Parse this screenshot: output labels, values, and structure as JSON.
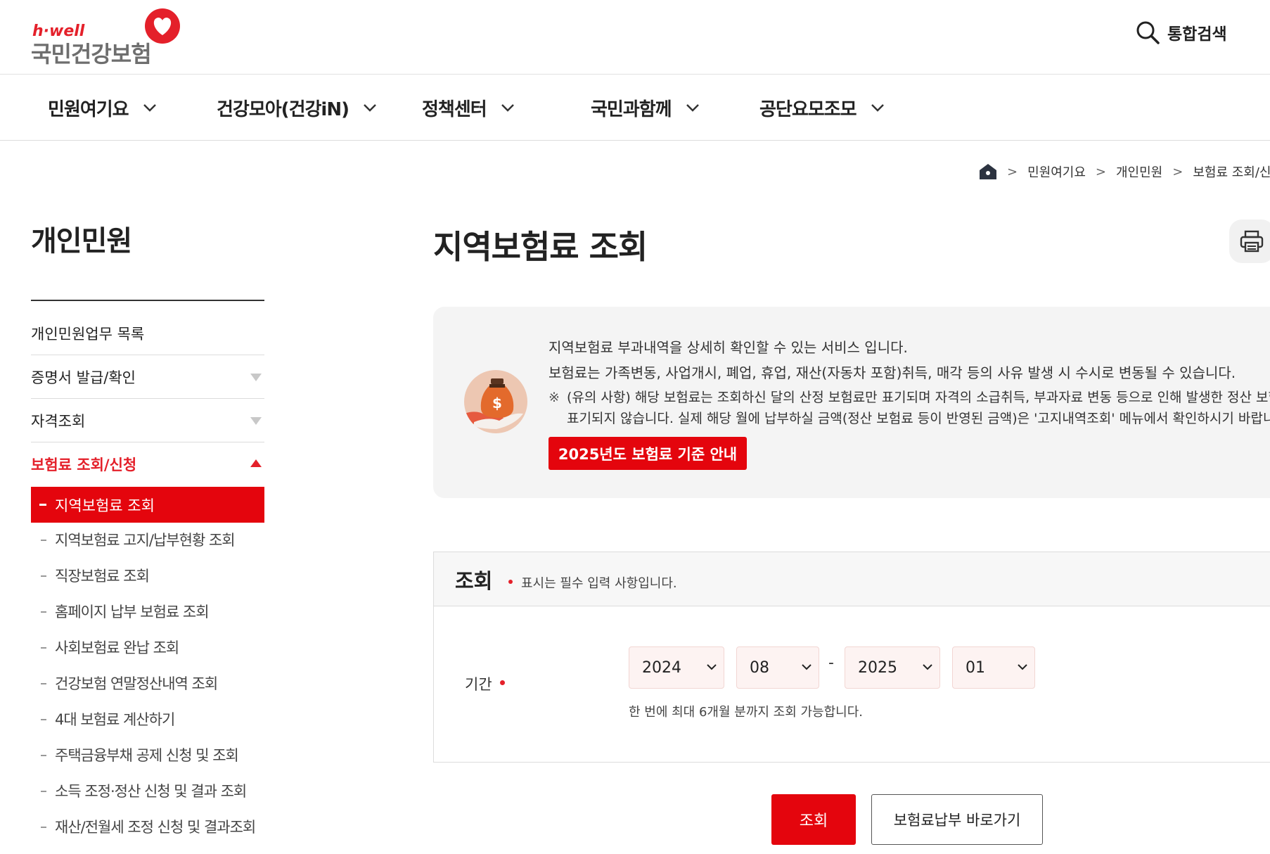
{
  "header": {
    "logo_sub": "h·well",
    "logo_main": "국민건강보험",
    "search_label": "통합검색"
  },
  "gnb": [
    "민원여기요",
    "건강모아(건강iN)",
    "정책센터",
    "국민과함께",
    "공단요모조모"
  ],
  "breadcrumb": [
    "민원여기요",
    "개인민원",
    "보험료 조회/신청"
  ],
  "lnb": {
    "title": "개인민원",
    "items": [
      {
        "label": "개인민원업무 목록"
      },
      {
        "label": "증명서 발급/확인"
      },
      {
        "label": "자격조회"
      },
      {
        "label": "보험료 조회/신청"
      }
    ],
    "sub_items": [
      "지역보험료 조회",
      "지역보험료 고지/납부현황 조회",
      "직장보험료 조회",
      "홈페이지 납부 보험료 조회",
      "사회보험료 완납 조회",
      "건강보험 연말정산내역 조회",
      "4대 보험료 계산하기",
      "주택금융부채 공제 신청 및 조회",
      "소득 조정·정산 신청 및 결과 조회",
      "재산/전월세 조정 신청 및 결과조회"
    ]
  },
  "main": {
    "title": "지역보험료 조회",
    "info": {
      "line1": "지역보험료 부과내역을 상세히 확인할 수 있는 서비스 입니다.",
      "line2": "보험료는 가족변동, 사업개시, 폐업, 휴업, 재산(자동차 포함)취득, 매각 등의 사유 발생 시 수시로 변동될 수 있습니다.",
      "note_mark": "※",
      "note1": "(유의 사항) 해당 보험료는 조회하신 달의 산정 보험료만 표기되며 자격의 소급취득, 부과자료 변동 등으로 인해 발생한 정산 보험료 등은",
      "note2": "표기되지 않습니다. 실제 해당 월에 납부하실 금액(정산 보험료 등이 반영된 금액)은 '고지내역조회' 메뉴에서 확인하시기 바랍니다.",
      "button": "2025년도 보험료 기준 안내"
    },
    "form": {
      "title": "조회",
      "required_note": "표시는 필수 입력 사항입니다.",
      "period_label": "기간",
      "from_year": "2024",
      "from_month": "08",
      "separator": "-",
      "to_year": "2025",
      "to_month": "01",
      "help": "한 번에 최대 6개월 분까지 조회 가능합니다."
    },
    "buttons": {
      "search": "조회",
      "pay": "보험료납부 바로가기"
    }
  },
  "colors": {
    "brand_red": "#e4050d",
    "text": "#222222",
    "info_bg": "#f4f4f4"
  }
}
